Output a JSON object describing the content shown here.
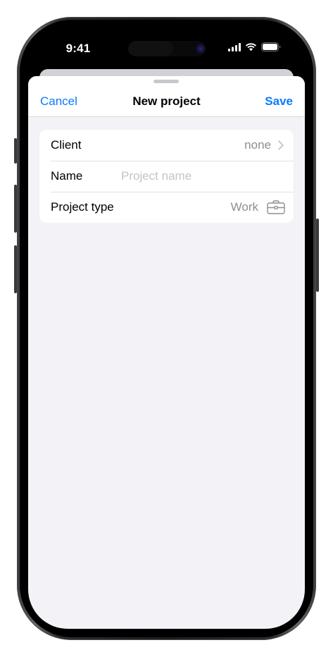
{
  "status_bar": {
    "time": "9:41"
  },
  "sheet": {
    "cancel_label": "Cancel",
    "title": "New project",
    "save_label": "Save"
  },
  "form": {
    "client": {
      "label": "Client",
      "value": "none",
      "icon": "chevron-right-icon"
    },
    "name": {
      "label": "Name",
      "value": "",
      "placeholder": "Project name"
    },
    "project_type": {
      "label": "Project type",
      "value": "Work",
      "icon": "briefcase-icon"
    }
  },
  "colors": {
    "accent": "#0a7aff",
    "background": "#f2f2f7",
    "secondary_text": "#8e8e93"
  }
}
